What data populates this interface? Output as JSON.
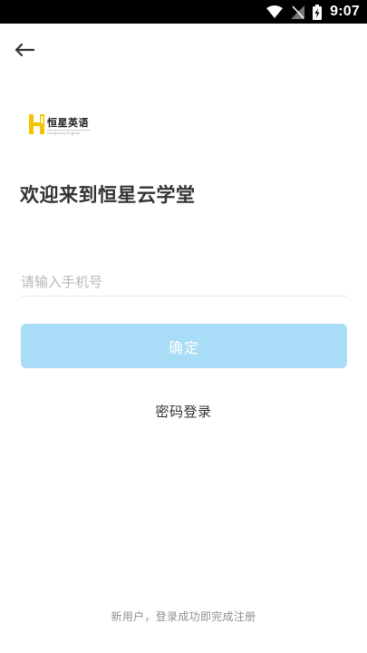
{
  "status_bar": {
    "time": "9:07",
    "icons": [
      "wifi-icon",
      "signal-off-icon",
      "battery-charging-icon"
    ]
  },
  "nav": {
    "back_icon": "arrow-left-icon"
  },
  "logo": {
    "text": "恒星英语",
    "sub": "HengXing English",
    "mark_color": "#f5c400"
  },
  "title": "欢迎来到恒星云学堂",
  "phone_input": {
    "placeholder": "请输入手机号",
    "value": ""
  },
  "confirm_button": {
    "label": "确定",
    "color": "#a8dcf7"
  },
  "password_login": {
    "label": "密码登录"
  },
  "footer": {
    "note": "新用户，登录成功即完成注册"
  }
}
